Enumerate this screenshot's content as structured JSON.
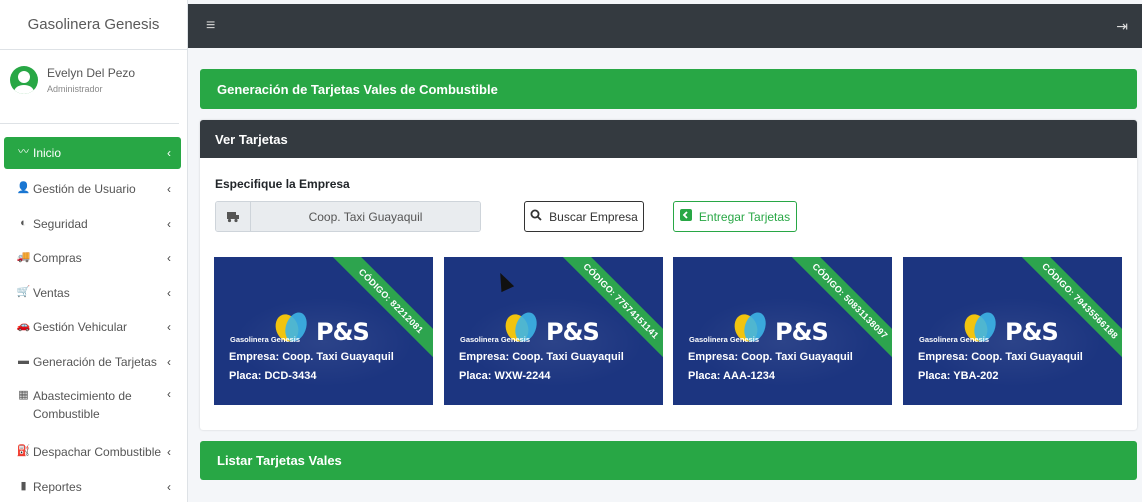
{
  "sidebar": {
    "brand": "Gasolinera Genesis",
    "user": {
      "name": "Evelyn Del Pezo",
      "role": "Administrador"
    },
    "items": [
      {
        "label": "Inicio",
        "icon": "chart-line-icon",
        "glyph": "〰",
        "active": true
      },
      {
        "label": "Gestión de Usuario",
        "icon": "user-icon",
        "glyph": "👤"
      },
      {
        "label": "Seguridad",
        "icon": "shield-icon",
        "glyph": "◐"
      },
      {
        "label": "Compras",
        "icon": "truck-icon",
        "glyph": "🚚"
      },
      {
        "label": "Ventas",
        "icon": "cart-icon",
        "glyph": "🛒"
      },
      {
        "label": "Gestión Vehicular",
        "icon": "car-icon",
        "glyph": "🚗"
      },
      {
        "label": "Generación de Tarjetas",
        "icon": "credit-card-icon",
        "glyph": "▬"
      },
      {
        "label": "Abastecimiento de Combustible",
        "icon": "dumpster-icon",
        "glyph": "▦"
      },
      {
        "label": "Despachar Combustible",
        "icon": "gas-pump-icon",
        "glyph": "⛽"
      },
      {
        "label": "Reportes",
        "icon": "bar-chart-icon",
        "glyph": "▮"
      }
    ]
  },
  "topbar": {
    "menu_glyph": "≡",
    "logout_glyph": "⇥"
  },
  "main": {
    "page_header": "Generación de Tarjetas Vales de Combustible",
    "ver_tarjetas": {
      "title": "Ver Tarjetas",
      "empresa_label": "Especifique la Empresa",
      "empresa_value": "Coop. Taxi Guayaquil",
      "buscar_button": "Buscar Empresa",
      "entregar_button": "Entregar Tarjetas"
    },
    "cards": [
      {
        "codigo": "CÓDIGO: 82212081",
        "empresa": "Empresa: Coop. Taxi Guayaquil",
        "placa": "Placa: DCD-3434"
      },
      {
        "codigo": "CÓDIGO: 77574151141",
        "empresa": "Empresa: Coop. Taxi Guayaquil",
        "placa": "Placa: WXW-2244"
      },
      {
        "codigo": "CÓDIGO: 50831138097",
        "empresa": "Empresa: Coop. Taxi Guayaquil",
        "placa": "Placa: AAA-1234"
      },
      {
        "codigo": "CÓDIGO: 79435566188",
        "empresa": "Empresa: Coop. Taxi Guayaquil",
        "placa": "Placa: YBA-202"
      }
    ],
    "card_brand": {
      "gasolinera": "Gasolinera Genesis",
      "ps": "P&S"
    },
    "listar_header": "Listar Tarjetas Vales"
  },
  "colors": {
    "accent": "#28a745",
    "dark": "#343a40",
    "card_bg": "#1c3580"
  }
}
